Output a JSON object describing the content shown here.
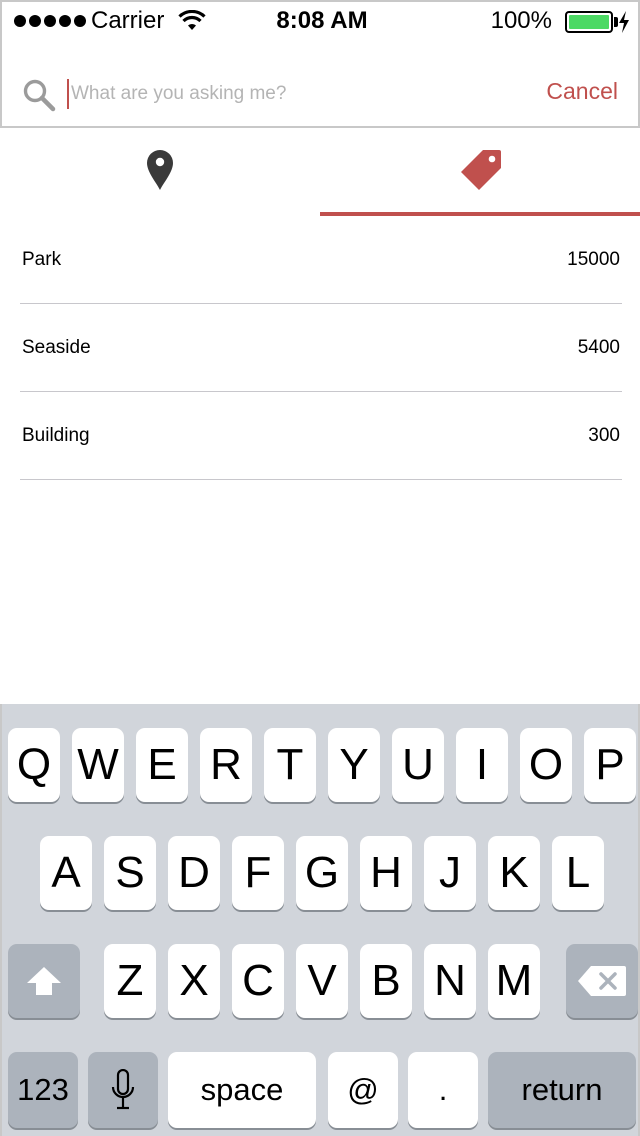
{
  "status_bar": {
    "carrier": "Carrier",
    "time": "8:08 AM",
    "battery_percent": "100%",
    "battery_level": 1.0,
    "signal_icon": "signal-dots-icon",
    "wifi_icon": "wifi-icon",
    "battery_icon": "battery-icon",
    "charging_icon": "charging-bolt-icon"
  },
  "search": {
    "placeholder": "What are you asking me?",
    "value": "",
    "cancel_label": "Cancel",
    "icon": "search-icon"
  },
  "tabs": [
    {
      "icon": "map-pin-icon",
      "selected": false
    },
    {
      "icon": "tag-icon",
      "selected": true
    }
  ],
  "accent_color": "#c0504d",
  "list": [
    {
      "name": "Park",
      "value": "15000"
    },
    {
      "name": "Seaside",
      "value": "5400"
    },
    {
      "name": "Building",
      "value": "300"
    }
  ],
  "keyboard": {
    "row1": [
      "Q",
      "W",
      "E",
      "R",
      "T",
      "Y",
      "U",
      "I",
      "O",
      "P"
    ],
    "row2": [
      "A",
      "S",
      "D",
      "F",
      "G",
      "H",
      "J",
      "K",
      "L"
    ],
    "row3": [
      "Z",
      "X",
      "C",
      "V",
      "B",
      "N",
      "M"
    ],
    "numbers_label": "123",
    "space_label": "space",
    "at_label": "@",
    "period_label": ".",
    "return_label": "return",
    "shift_icon": "shift-icon",
    "delete_icon": "delete-icon",
    "mic_icon": "microphone-icon"
  }
}
